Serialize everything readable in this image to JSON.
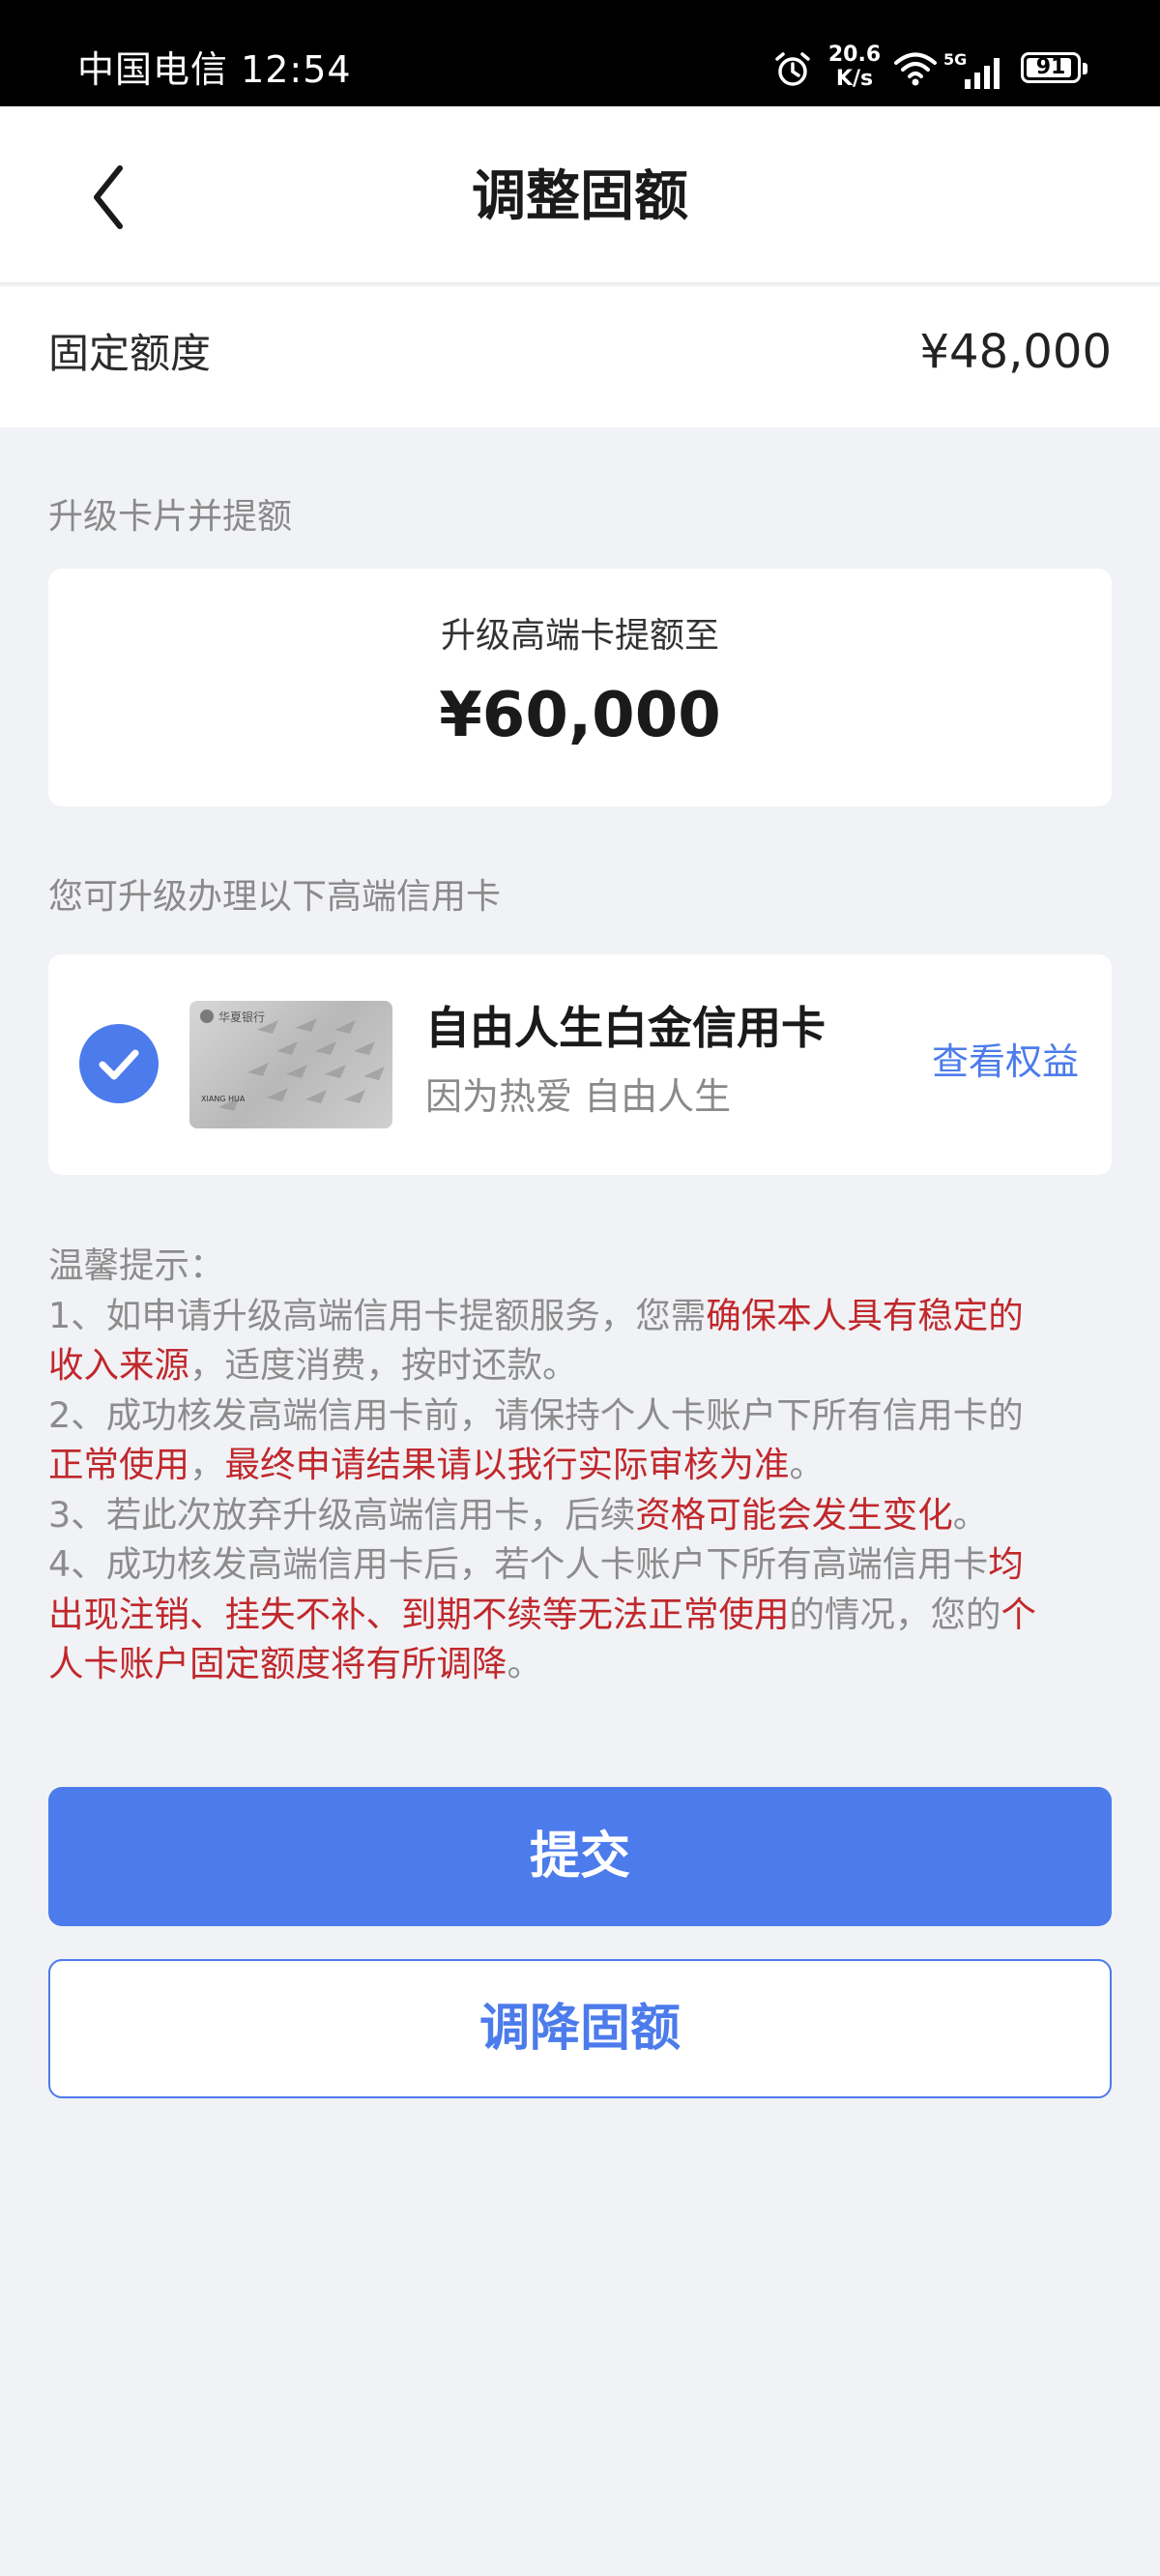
{
  "status_bar": {
    "carrier_time": "中国电信 12:54",
    "net_speed": "20.6",
    "net_speed_unit": "K/s",
    "network_type": "5G",
    "battery": "91",
    "battery_level_pct": 91,
    "icons": [
      "alarm-icon",
      "wifi-icon",
      "signal-icon",
      "battery-icon"
    ]
  },
  "nav": {
    "back_icon": "chevron-left-icon",
    "title": "调整固额"
  },
  "fixed_limit": {
    "label": "固定额度",
    "value": "¥48,000"
  },
  "upgrade_section": {
    "label": "升级卡片并提额",
    "caption": "升级高端卡提额至",
    "amount": "¥60,000"
  },
  "card_section": {
    "label": "您可升级办理以下高端信用卡",
    "selected": true,
    "card_name": "自由人生白金信用卡",
    "slogan": "因为热爱 自由人生",
    "link": "查看权益",
    "card_bank_text": "华夏银行",
    "card_holder_text": "XIANG HUA"
  },
  "tips": {
    "title": "温馨提示：",
    "l1a": "1、如申请升级高端信用卡提额服务，您需",
    "l1b": "确保本人具有稳定的",
    "l2a": "收入来源",
    "l2b": "，适度消费，按时还款。",
    "l3": "2、成功核发高端信用卡前，请保持个人卡账户下所有信用卡的",
    "l4a": "正常使用",
    "l4b": "，",
    "l4c": "最终申请结果请以我行实际审核为准",
    "l4d": "。",
    "l5a": "3、若此次放弃升级高端信用卡，后续",
    "l5b": "资格可能会发生变化",
    "l5c": "。",
    "l6a": "4、成功核发高端信用卡后，若个人卡账户下所有高端信用卡",
    "l6b": "均",
    "l7a": "出现注销、挂失不补、到期不续等无法正常使用",
    "l7b": "的情况，您的",
    "l7c": "个",
    "l8a": "人卡账户固定额度将有所调降",
    "l8b": "。"
  },
  "buttons": {
    "submit": "提交",
    "reduce": "调降固额"
  },
  "colors": {
    "accent": "#4c7beb",
    "warning_red": "#c0282c",
    "page_bg": "#f1f2f5"
  }
}
